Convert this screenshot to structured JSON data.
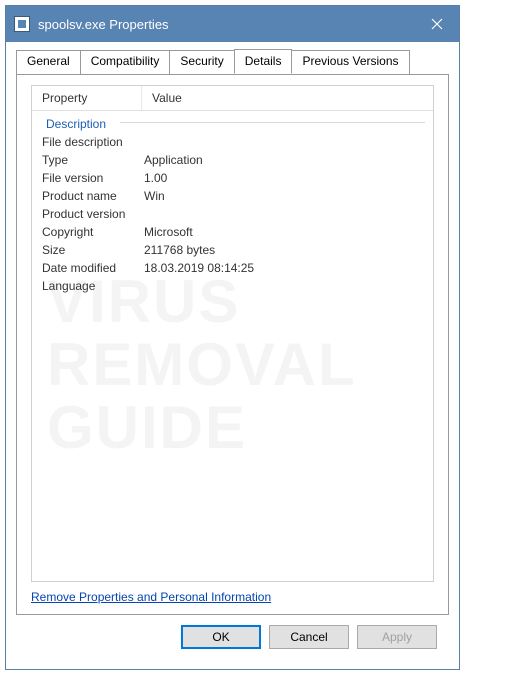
{
  "titlebar": {
    "title": "spoolsv.exe Properties"
  },
  "tabs": [
    {
      "label": "General"
    },
    {
      "label": "Compatibility"
    },
    {
      "label": "Security"
    },
    {
      "label": "Details"
    },
    {
      "label": "Previous Versions"
    }
  ],
  "details": {
    "header_property": "Property",
    "header_value": "Value",
    "section": "Description",
    "rows": [
      {
        "property": "File description",
        "value": ""
      },
      {
        "property": "Type",
        "value": "Application"
      },
      {
        "property": "File version",
        "value": "1.00"
      },
      {
        "property": "Product name",
        "value": "Win"
      },
      {
        "property": "Product version",
        "value": ""
      },
      {
        "property": "Copyright",
        "value": "Microsoft"
      },
      {
        "property": "Size",
        "value": "211768 bytes"
      },
      {
        "property": "Date modified",
        "value": "18.03.2019 08:14:25"
      },
      {
        "property": "Language",
        "value": ""
      }
    ]
  },
  "link": "Remove Properties and Personal Information",
  "buttons": {
    "ok": "OK",
    "cancel": "Cancel",
    "apply": "Apply"
  },
  "watermark": {
    "l1": "VIRUS",
    "l2": "REMOVAL",
    "l3": "GUIDE"
  }
}
